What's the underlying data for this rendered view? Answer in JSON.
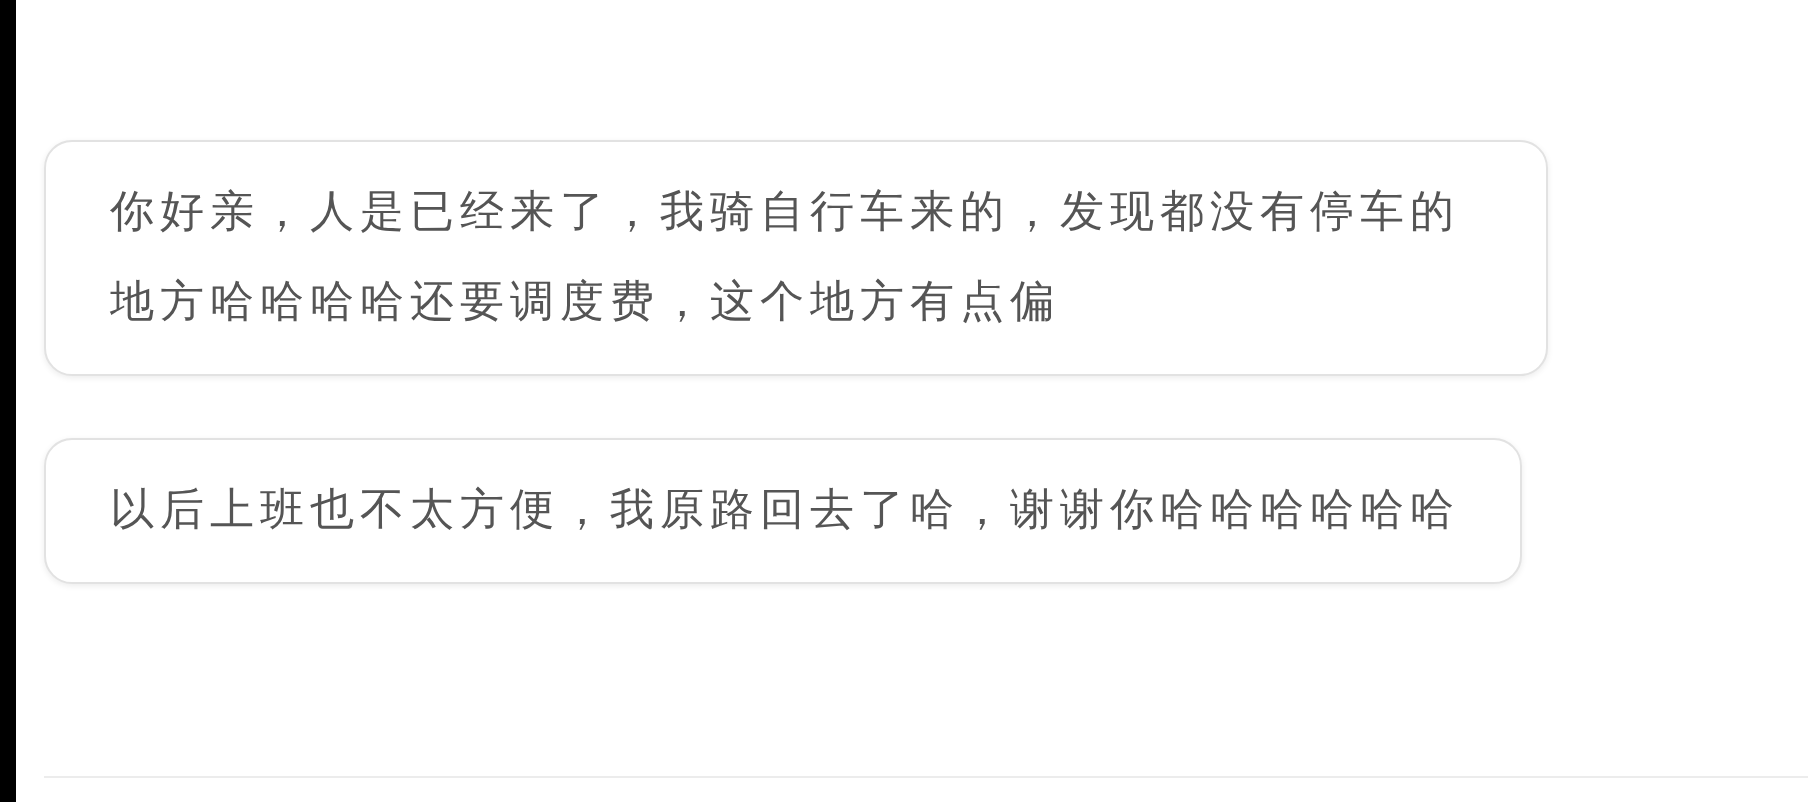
{
  "messages": [
    {
      "text": "你好亲，人是已经来了，我骑自行车来的，发现都没有停车的地方哈哈哈哈还要调度费，这个地方有点偏"
    },
    {
      "text": "以后上班也不太方便，我原路回去了哈，谢谢你哈哈哈哈哈哈"
    }
  ]
}
